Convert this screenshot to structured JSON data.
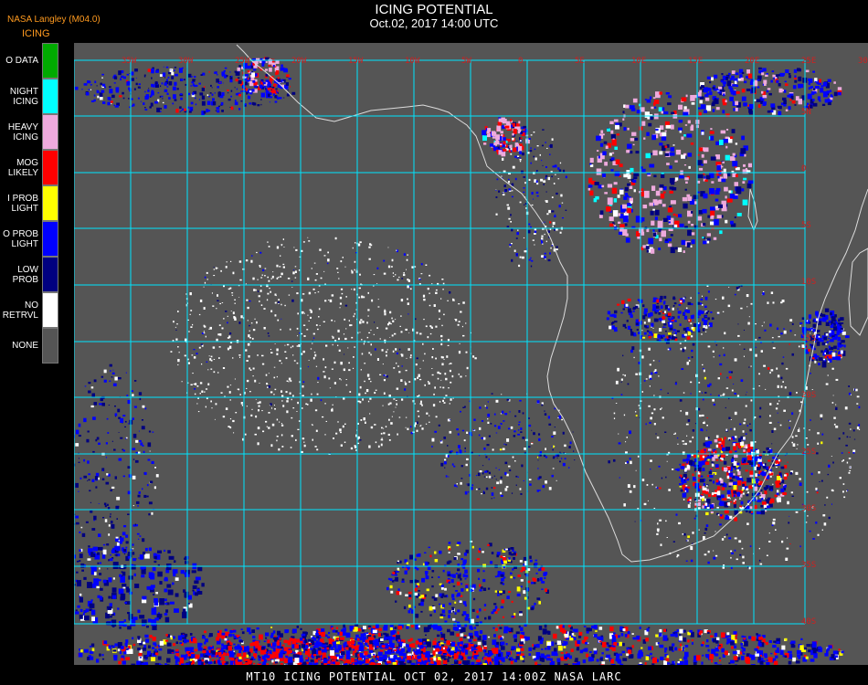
{
  "header": {
    "title": "ICING POTENTIAL",
    "subtitle": "Oct.02, 2017 14:00 UTC",
    "agency": "NASA Langley (M04.0)"
  },
  "legend": {
    "title": "ICING",
    "items": [
      {
        "label": "O DATA",
        "color": "#00aa00"
      },
      {
        "label": "NIGHT\nICING",
        "color": "#00ffff"
      },
      {
        "label": "HEAVY\nICING",
        "color": "#eeaadd"
      },
      {
        "label": "MOG\nLIKELY",
        "color": "#ff0000"
      },
      {
        "label": "I PROB\nLIGHT",
        "color": "#ffff00"
      },
      {
        "label": "O PROB\nLIGHT",
        "color": "#0000ff"
      },
      {
        "label": "LOW\nPROB",
        "color": "#000080"
      },
      {
        "label": "NO\nRETRVL",
        "color": "#ffffff"
      },
      {
        "label": "NONE",
        "color": "#555555"
      }
    ]
  },
  "map": {
    "background_color": "#555555",
    "grid_color": "#00e5ff",
    "coastline_color": "#dddddd",
    "lon_labels": [
      "35W",
      "30W",
      "25W",
      "20W",
      "15W",
      "10W",
      "5W",
      "0",
      "5E",
      "10E",
      "15E",
      "20E",
      "25E",
      "30E",
      "35E"
    ],
    "lat_labels": [
      "5N",
      "0",
      "5S",
      "10S",
      "15S",
      "20S",
      "25S",
      "30S",
      "35S",
      "40S"
    ]
  },
  "footer": {
    "text": "MT10  ICING POTENTIAL   OCT 02, 2017 14:00Z   NASA LARC"
  }
}
